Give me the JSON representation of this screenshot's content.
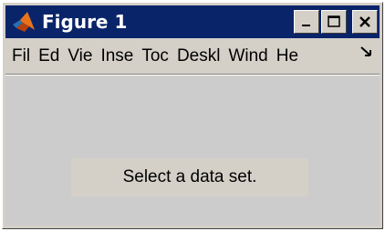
{
  "window": {
    "title": "Figure 1",
    "icon": "matlab-logo-icon",
    "buttons": {
      "minimize_icon": "minimize-icon",
      "maximize_icon": "maximize-icon",
      "close_icon": "close-icon"
    }
  },
  "menubar": {
    "items": [
      "Fil",
      "Ed",
      "Vie",
      "Inse",
      "Toc",
      "Deskl",
      "Wind",
      "He"
    ],
    "overflow_icon": "chevron-double-right-icon"
  },
  "figure": {
    "message": "Select a data set."
  },
  "colors": {
    "titlebar": "#0a246a",
    "chrome": "#d4d0c8",
    "canvas": "#cccccc"
  }
}
